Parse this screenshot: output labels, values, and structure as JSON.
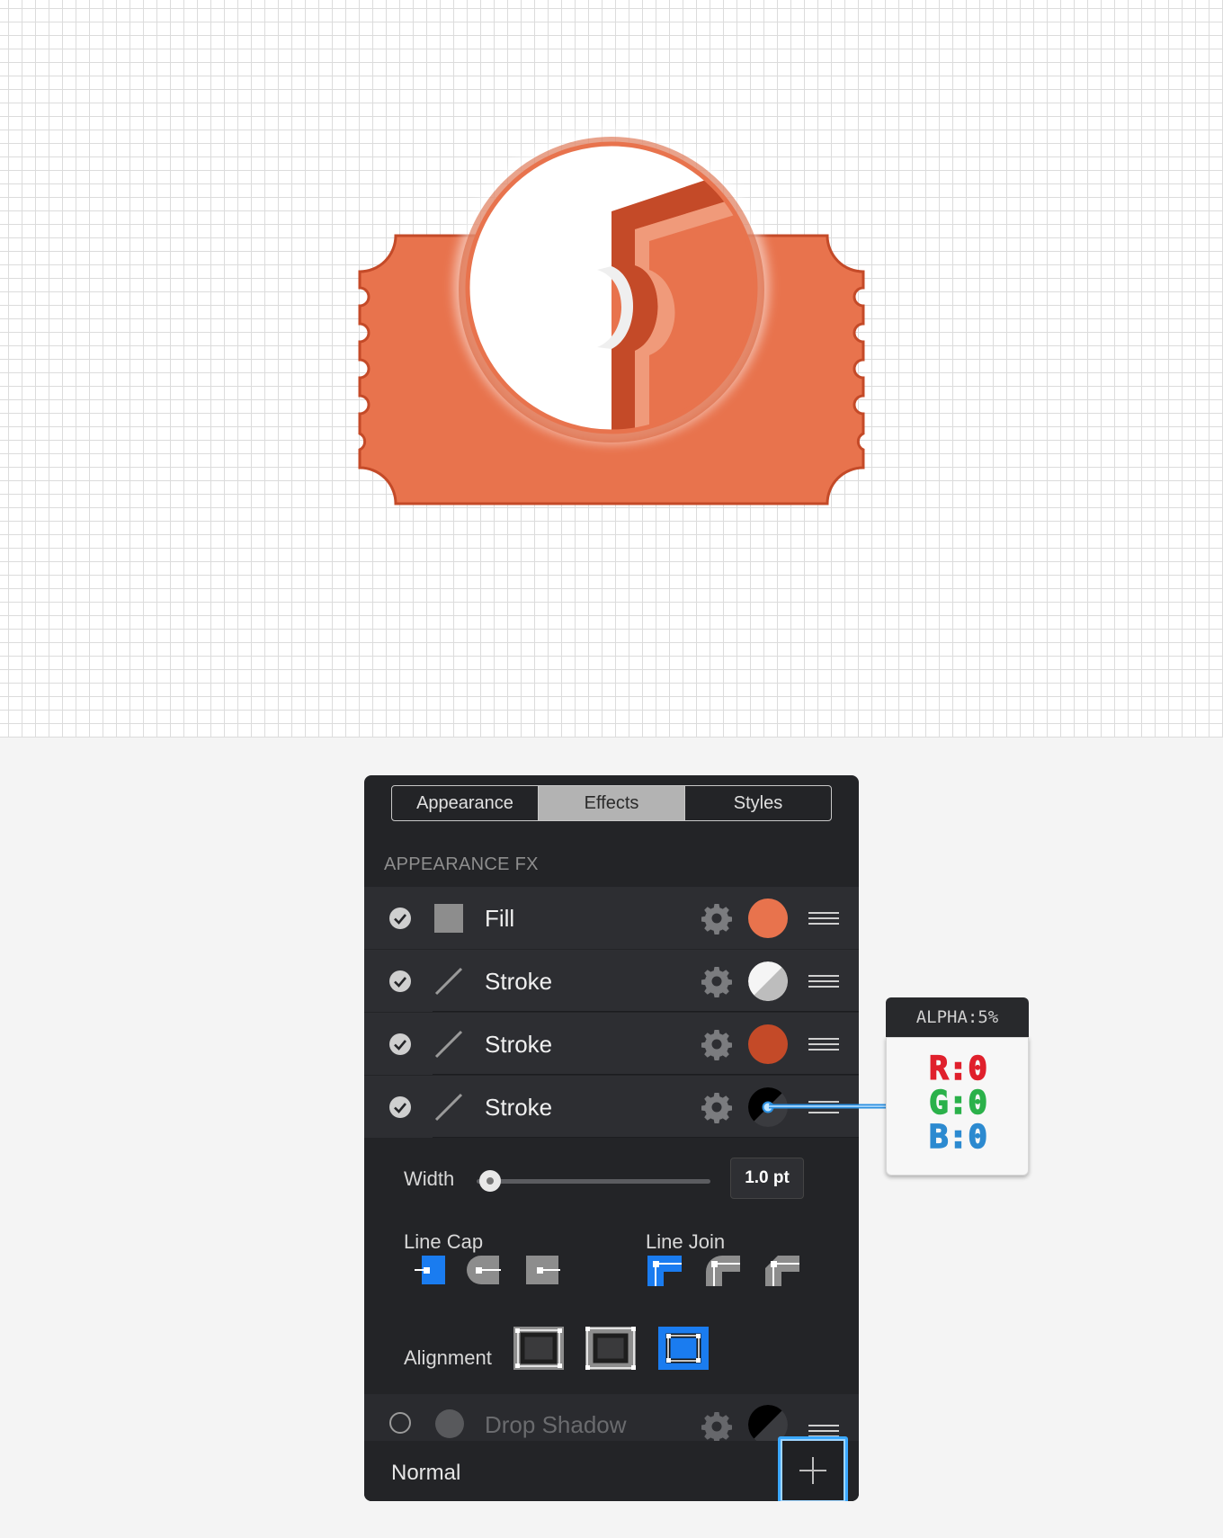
{
  "tabs": [
    "Appearance",
    "Effects",
    "Styles"
  ],
  "active_tab": "Effects",
  "section_label": "APPEARANCE FX",
  "rows": [
    {
      "label": "Fill",
      "icon": "square-fill-icon",
      "swatch": "#e8734d",
      "checked": true
    },
    {
      "label": "Stroke",
      "icon": "stroke-line-icon",
      "swatch": "white-grey-split",
      "checked": true
    },
    {
      "label": "Stroke",
      "icon": "stroke-line-icon",
      "swatch": "#c44a28",
      "checked": true
    },
    {
      "label": "Stroke",
      "icon": "stroke-line-icon",
      "swatch": "black-transparent-split",
      "checked": true
    }
  ],
  "stroke_options": {
    "width_label": "Width",
    "width_value": "1.0 pt",
    "width_level": 0.05,
    "line_cap_label": "Line Cap",
    "line_join_label": "Line Join",
    "alignment_label": "Alignment",
    "selected_cap": "butt",
    "selected_join": "miter",
    "selected_alignment": "outside"
  },
  "drop_shadow": {
    "label": "Drop Shadow",
    "checked": false
  },
  "blend_mode": "Normal",
  "tooltip": {
    "header": "ALPHA:5%",
    "r": "R:0",
    "g": "G:0",
    "b": "B:0"
  },
  "colors": {
    "accent_blue": "#1a7cf0",
    "ticket_orange": "#e8734d",
    "ticket_dark": "#c44a28",
    "panel_bg": "#232427",
    "red": "#e0202c",
    "green": "#2bb14a",
    "blue": "#2c8ad0"
  }
}
